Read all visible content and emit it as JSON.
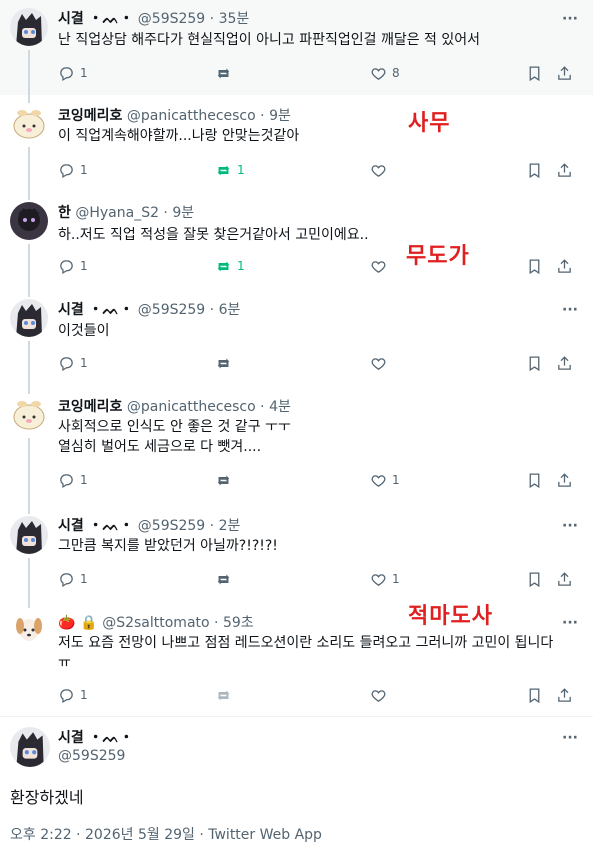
{
  "thread": [
    {
      "name": "시결 ・ᨓ・",
      "handle": "@59S259",
      "time": "35분",
      "text": [
        "난 직업상담 해주다가 현실직업이 아니고 파판직업인걸 깨달은 적 있어서"
      ],
      "reply": "1",
      "retweet": "",
      "like": "8",
      "retweet_active": false
    },
    {
      "name": "코잉메리호",
      "handle": "@panicatthecesco",
      "time": "9분",
      "text": [
        "이 직업계속해야할까...나랑 안맞는것같아"
      ],
      "reply": "1",
      "retweet": "1",
      "like": "",
      "retweet_active": true
    },
    {
      "name": "한",
      "handle": "@Hyana_S2",
      "time": "9분",
      "text": [
        "하..저도 직업 적성을 잘못 찾은거같아서 고민이에요.."
      ],
      "reply": "1",
      "retweet": "1",
      "like": "",
      "retweet_active": true
    },
    {
      "name": "시결 ・ᨓ・",
      "handle": "@59S259",
      "time": "6분",
      "text": [
        "이것들이"
      ],
      "reply": "1",
      "retweet": "",
      "like": "",
      "retweet_active": false
    },
    {
      "name": "코잉메리호",
      "handle": "@panicatthecesco",
      "time": "4분",
      "text": [
        "사회적으로 인식도 안 좋은 것 같구 ㅜㅜ",
        "열심히 벌어도 세금으로 다 뺏겨...."
      ],
      "reply": "1",
      "retweet": "",
      "like": "1",
      "retweet_active": false
    },
    {
      "name": "시결 ・ᨓ・",
      "handle": "@59S259",
      "time": "2분",
      "text": [
        "그만큼 복지를 받았던거 아닐까?!?!?!"
      ],
      "reply": "1",
      "retweet": "",
      "like": "1",
      "retweet_active": false
    },
    {
      "name": "🍅 🔒",
      "handle": "@S2salttomato",
      "time": "59초",
      "text": [
        "저도 요즘 전망이 나쁘고 점점 레드오션이란 소리도 들려오고 그러니까 고민이 됩니다",
        "ㅠ"
      ],
      "reply": "1",
      "retweet": "",
      "like": "",
      "retweet_active": false
    }
  ],
  "annotations": [
    "사무",
    "무도가",
    "적마도사"
  ],
  "main": {
    "name": "시결 ・ᨓ・",
    "handle": "@59S259",
    "text": "환장하겠네",
    "timestamp": "오후 2:22 · 2026년 5월 29일 · Twitter Web App"
  },
  "more_label": "···",
  "icons": {
    "reply": "reply-icon",
    "retweet": "retweet-icon",
    "like": "heart-icon",
    "bookmark": "bookmark-icon",
    "share": "share-icon",
    "more": "more-icon"
  },
  "colors": {
    "green": "#00ba7c",
    "grey": "#536471",
    "red": "#e02020",
    "line": "#cfd9de"
  }
}
